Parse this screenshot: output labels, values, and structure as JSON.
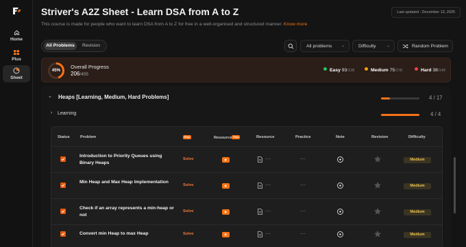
{
  "sidebar": {
    "logo_alt": "TUF",
    "items": [
      {
        "label": "Home",
        "icon": "home-icon",
        "active": false
      },
      {
        "label": "Plus",
        "icon": "plus-icon",
        "active": false
      },
      {
        "label": "Sheet",
        "icon": "sheet-icon",
        "active": true
      }
    ]
  },
  "header": {
    "title": "Striver's A2Z Sheet - Learn DSA from A to Z",
    "last_updated": "Last updated : December 13, 2025",
    "subtitle": "This course is made for people who want to learn DSA from A to Z for free in a well-organised and structured manner.",
    "know_more": "Know more"
  },
  "toolbar": {
    "tabs": [
      "All Problems",
      "Revision"
    ],
    "active_tab": "All Problems",
    "filter_label": "All problems",
    "difficulty_label": "Difficulty",
    "random_label": "Random Problem"
  },
  "progress": {
    "percent_label": "45%",
    "percent_value": 45,
    "label": "Overall Progress",
    "done": "206",
    "total": "455",
    "easy": {
      "label": "Easy",
      "done": "93",
      "total": "128",
      "color": "#22c55e"
    },
    "medium": {
      "label": "Medium",
      "done": "75",
      "total": "178",
      "color": "#f59e0b"
    },
    "hard": {
      "label": "Hard",
      "done": "38",
      "total": "149",
      "color": "#ef4444"
    }
  },
  "topic": {
    "title": "Heaps [Learning, Medium, Hard Problems]",
    "count": "4 / 17",
    "fraction": 0.235,
    "sub": {
      "title": "Learning",
      "count": "4 / 4",
      "fraction": 1.0
    }
  },
  "table": {
    "headers": {
      "status": "Status",
      "problem": "Problem",
      "plus_tag": "Plus",
      "resource_plus": "Resource",
      "resource": "Resource",
      "practice": "Practice",
      "note": "Note",
      "revision": "Revision",
      "difficulty": "Difficulty"
    },
    "rows": [
      {
        "problem": "Introduction to Priority Queues using Binary Heaps",
        "solve": "Solve",
        "practice": "---",
        "resource_dash": "---",
        "difficulty": "Medium",
        "done": true
      },
      {
        "problem": "Min Heap and Max Heap Implementation",
        "solve": "Solve",
        "practice": "---",
        "resource_dash": "---",
        "difficulty": "Medium",
        "done": true
      },
      {
        "problem": "Check if an array represents a min-heap or not",
        "solve": "Solve",
        "practice": "---",
        "resource_dash": "---",
        "difficulty": "Medium",
        "done": true
      },
      {
        "problem": "Convert min Heap to max Heap",
        "solve": "Solve",
        "practice": "---",
        "resource_dash": "---",
        "difficulty": "Medium",
        "done": true
      }
    ]
  }
}
